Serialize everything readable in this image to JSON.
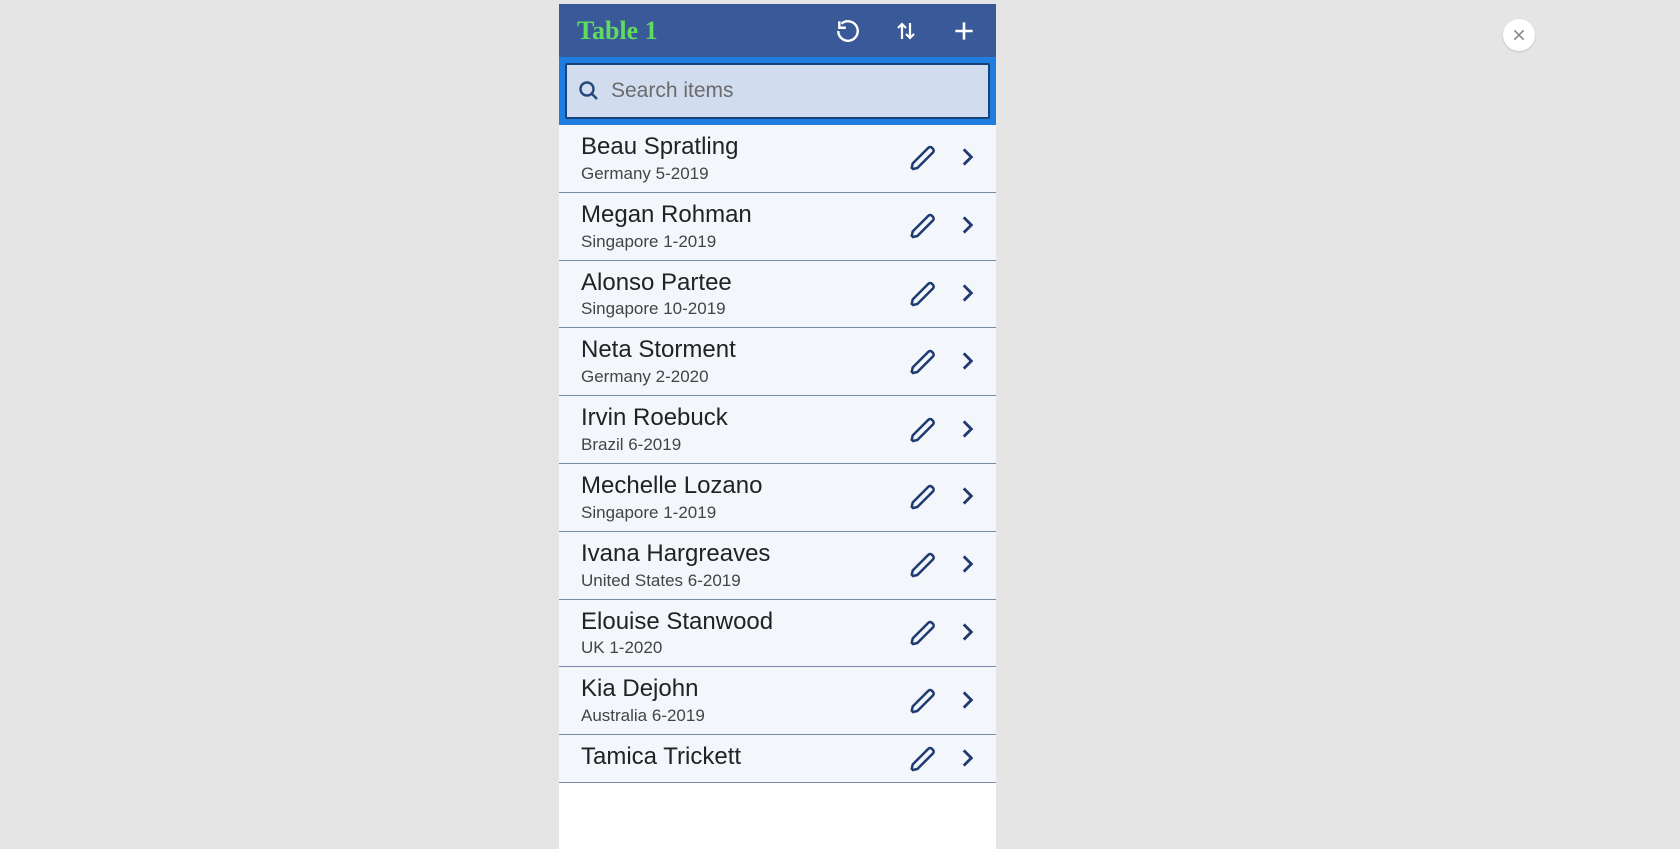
{
  "header": {
    "title": "Table 1"
  },
  "search": {
    "placeholder": "Search items",
    "value": ""
  },
  "rows": [
    {
      "name": "Beau Spratling",
      "detail": "Germany 5-2019"
    },
    {
      "name": "Megan Rohman",
      "detail": "Singapore 1-2019"
    },
    {
      "name": "Alonso Partee",
      "detail": "Singapore 10-2019"
    },
    {
      "name": "Neta Storment",
      "detail": "Germany 2-2020"
    },
    {
      "name": "Irvin Roebuck",
      "detail": "Brazil 6-2019"
    },
    {
      "name": "Mechelle Lozano",
      "detail": "Singapore 1-2019"
    },
    {
      "name": "Ivana Hargreaves",
      "detail": "United States 6-2019"
    },
    {
      "name": "Elouise Stanwood",
      "detail": "UK 1-2020"
    },
    {
      "name": "Kia Dejohn",
      "detail": "Australia 6-2019"
    },
    {
      "name": "Tamica Trickett",
      "detail": ""
    }
  ]
}
